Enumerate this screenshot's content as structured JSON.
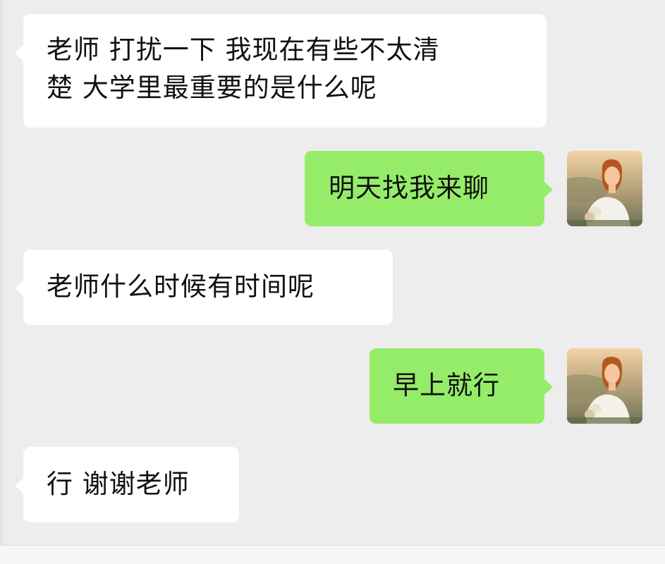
{
  "messages": [
    {
      "direction": "incoming",
      "line1": "老师 打扰一下 我现在有些不太清",
      "line2": "楚 大学里最重要的是什么呢"
    },
    {
      "direction": "outgoing",
      "text": "明天找我来聊"
    },
    {
      "direction": "incoming",
      "text": "老师什么时候有时间呢"
    },
    {
      "direction": "outgoing",
      "text": "早上就行"
    },
    {
      "direction": "incoming",
      "text": "行 谢谢老师"
    }
  ],
  "colors": {
    "background": "#ededed",
    "incoming_bubble": "#ffffff",
    "outgoing_bubble": "#95ec69"
  },
  "icons": {
    "sender_avatar": "avatar-photo-icon"
  }
}
